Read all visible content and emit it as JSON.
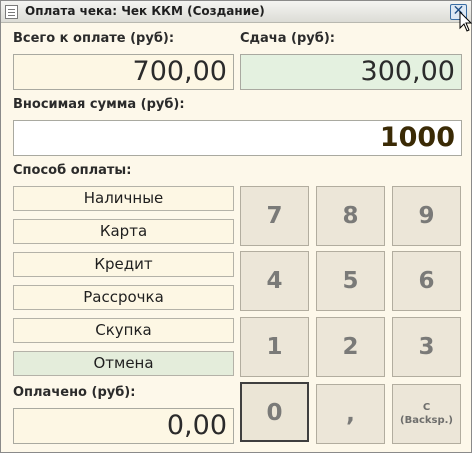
{
  "window": {
    "title": "Оплата чека: Чек ККМ (Создание)",
    "close_glyph": "✕"
  },
  "total": {
    "label": "Всего к оплате (руб):",
    "value": "700,00"
  },
  "change": {
    "label": "Сдача (руб):",
    "value": "300,00"
  },
  "deposit": {
    "label": "Вносимая сумма (руб):",
    "value": "1000"
  },
  "payment_methods": {
    "label": "Способ оплаты:",
    "items": [
      "Наличные",
      "Карта",
      "Кредит",
      "Рассрочка",
      "Скупка"
    ],
    "cancel": "Отмена"
  },
  "paid": {
    "label": "Оплачено (руб):",
    "value": "0,00"
  },
  "keypad": {
    "keys": [
      "7",
      "8",
      "9",
      "4",
      "5",
      "6",
      "1",
      "2",
      "3",
      "0",
      ","
    ],
    "backspace": {
      "line1": "C",
      "line2": "(Backsp.)"
    }
  },
  "colors": {
    "background": "#fdf8ea",
    "field_green": "#e4f1e0",
    "key_face": "#ece6d8"
  }
}
